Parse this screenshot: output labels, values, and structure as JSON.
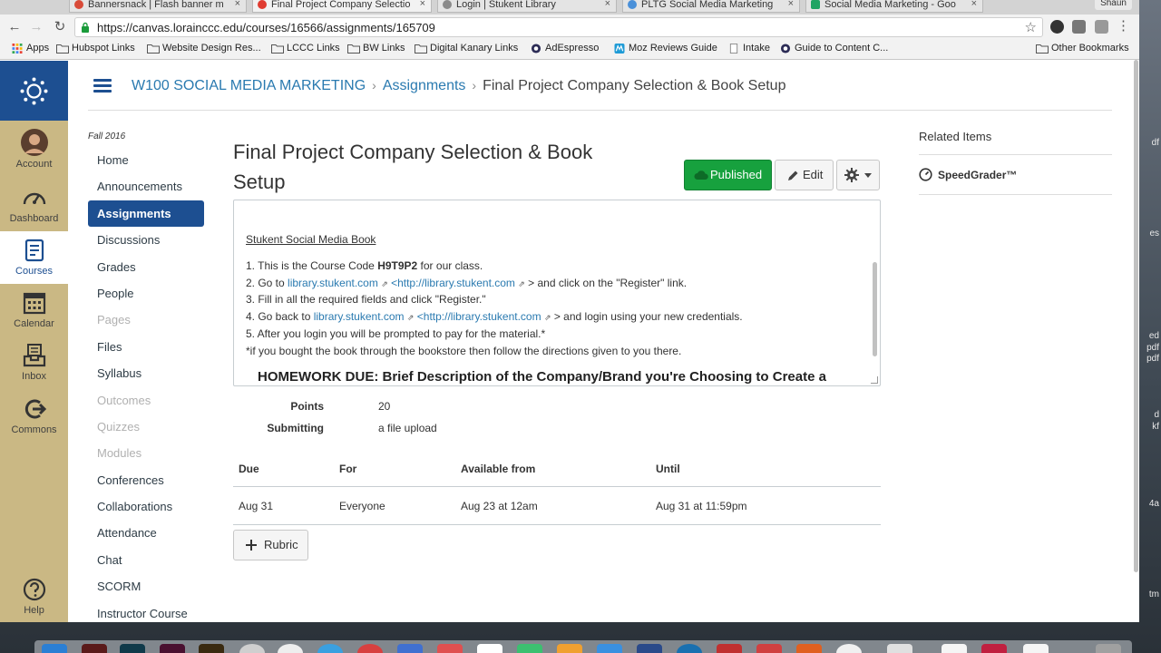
{
  "browser": {
    "tabs": [
      {
        "title": "Bannersnack | Flash banner m",
        "favicon_color": "#d84a38"
      },
      {
        "title": "Final Project Company Selectio",
        "favicon_color": "#e03c31"
      },
      {
        "title": "Login | Stukent Library",
        "favicon_color": "#8a8a8a"
      },
      {
        "title": "PLTG Social Media Marketing",
        "favicon_color": "#4a90d9"
      },
      {
        "title": "Social Media Marketing - Goo",
        "favicon_color": "#1fa463"
      }
    ],
    "tab_close": "×",
    "user": "Shaun",
    "back": "←",
    "forward": "→",
    "reload": "↻",
    "url": "https://canvas.lorainccc.edu/courses/16566/assignments/165709",
    "star": "☆",
    "menu": "⋮",
    "bookmarks": [
      {
        "label": "Apps",
        "icon": "apps-icon"
      },
      {
        "label": "Hubspot Links",
        "icon": "folder-icon"
      },
      {
        "label": "Website Design Res...",
        "icon": "folder-icon"
      },
      {
        "label": "LCCC Links",
        "icon": "folder-icon"
      },
      {
        "label": "BW Links",
        "icon": "folder-icon"
      },
      {
        "label": "Digital Kanary Links",
        "icon": "folder-icon"
      },
      {
        "label": "AdEspresso",
        "icon": "globe-icon"
      },
      {
        "label": "Moz Reviews Guide",
        "icon": "moz-icon"
      },
      {
        "label": "Intake",
        "icon": "page-icon"
      },
      {
        "label": "Guide to Content C...",
        "icon": "globe-icon"
      }
    ],
    "other_bookmarks": "Other Bookmarks"
  },
  "global_nav": [
    {
      "label": "Account",
      "icon": "avatar-icon",
      "active": false
    },
    {
      "label": "Dashboard",
      "icon": "dashboard-icon",
      "active": false
    },
    {
      "label": "Courses",
      "icon": "courses-icon",
      "active": true
    },
    {
      "label": "Calendar",
      "icon": "calendar-icon",
      "active": false
    },
    {
      "label": "Inbox",
      "icon": "inbox-icon",
      "active": false
    },
    {
      "label": "Commons",
      "icon": "commons-icon",
      "active": false
    },
    {
      "label": "Help",
      "icon": "help-icon",
      "active": false
    }
  ],
  "breadcrumbs": {
    "course": "W100 SOCIAL MEDIA MARKETING",
    "section": "Assignments",
    "current": "Final Project Company Selection & Book Setup",
    "separator": "›"
  },
  "course_nav": {
    "term": "Fall 2016",
    "items": [
      {
        "label": "Home",
        "state": "normal"
      },
      {
        "label": "Announcements",
        "state": "normal"
      },
      {
        "label": "Assignments",
        "state": "active"
      },
      {
        "label": "Discussions",
        "state": "normal"
      },
      {
        "label": "Grades",
        "state": "normal"
      },
      {
        "label": "People",
        "state": "normal"
      },
      {
        "label": "Pages",
        "state": "disabled"
      },
      {
        "label": "Files",
        "state": "normal"
      },
      {
        "label": "Syllabus",
        "state": "normal"
      },
      {
        "label": "Outcomes",
        "state": "disabled"
      },
      {
        "label": "Quizzes",
        "state": "disabled"
      },
      {
        "label": "Modules",
        "state": "disabled"
      },
      {
        "label": "Conferences",
        "state": "normal"
      },
      {
        "label": "Collaborations",
        "state": "normal"
      },
      {
        "label": "Attendance",
        "state": "normal"
      },
      {
        "label": "Chat",
        "state": "normal"
      },
      {
        "label": "SCORM",
        "state": "normal"
      },
      {
        "label": "Instructor Course",
        "state": "normal"
      }
    ]
  },
  "assignment": {
    "title": "Final Project Company Selection & Book Setup",
    "published_label": "Published",
    "edit_label": "Edit",
    "description": {
      "book_link": "Stukent Social Media Book",
      "step1_pre": "1. This is the Course Code ",
      "step1_code": "H9T9P2",
      "step1_post": " for our class.",
      "step2_pre": "2. Go to ",
      "step2_link": "library.stukent.com",
      "step2_url": "<http://library.stukent.com",
      "step2_post": "> and click on the \"Register\" link.",
      "step3": "3. Fill in all the required fields and click \"Register.\"",
      "step4_pre": "4. Go back to ",
      "step4_link": "library.stukent.com",
      "step4_url": "<http://library.stukent.com",
      "step4_post": "> and login using your new credentials.",
      "step5": "5. After you login you will be prompted to pay for the material.*",
      "note": "*if you bought the book through the bookstore then follow the directions given to you there.",
      "ext_glyph": "⇗",
      "homework": "HOMEWORK DUE: Brief Description of the Company/Brand you're Choosing to Create a"
    },
    "points_label": "Points",
    "points_value": "20",
    "submitting_label": "Submitting",
    "submitting_value": "a file upload",
    "dates_headers": {
      "due": "Due",
      "for": "For",
      "available": "Available from",
      "until": "Until"
    },
    "dates_row": {
      "due": "Aug 31",
      "for": "Everyone",
      "available": "Aug 23 at 12am",
      "until": "Aug 31 at 11:59pm"
    },
    "rubric_label": "Rubric"
  },
  "related": {
    "heading": "Related Items",
    "speedgrader": "SpeedGrader™"
  },
  "desktop_labels": [
    "df",
    "es",
    "",
    "ed",
    "pdf",
    "pdf",
    "d",
    "kf",
    "4a",
    "tm"
  ],
  "colors": {
    "canvas_blue": "#1d4f91",
    "nav_gold": "#cab884",
    "published_green": "#17a13e",
    "link_blue": "#2a7ab0"
  }
}
